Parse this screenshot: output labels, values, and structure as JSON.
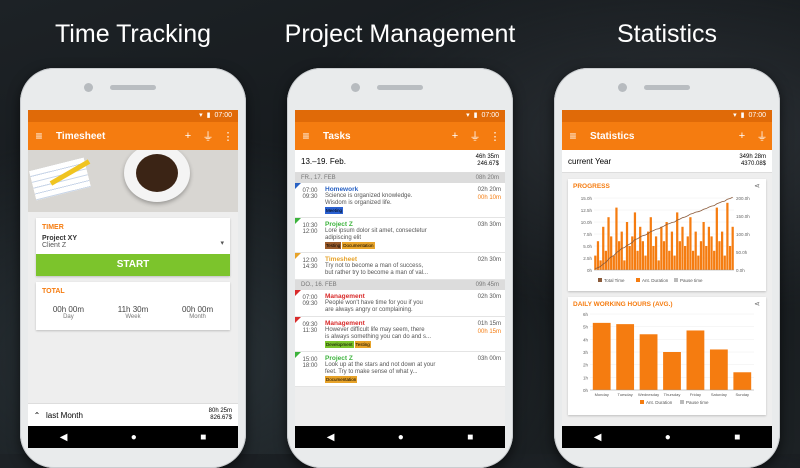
{
  "captions": [
    "Time Tracking",
    "Project Management",
    "Statistics"
  ],
  "status_time": "07:00",
  "nav": {
    "back": "◀",
    "home": "●",
    "recent": "■"
  },
  "timesheet": {
    "title": "Timesheet",
    "timer_label": "TIMER",
    "project": "Project XY",
    "client": "Client Z",
    "start_label": "START",
    "total_label": "TOTAL",
    "totals": [
      {
        "value": "00h 00m",
        "label": "Day"
      },
      {
        "value": "11h 30m",
        "label": "Week"
      },
      {
        "value": "00h 00m",
        "label": "Month"
      }
    ],
    "bottom": {
      "period": "last Month",
      "hours": "80h 25m",
      "amount": "826.67$"
    }
  },
  "tasks": {
    "title": "Tasks",
    "week": {
      "range": "13.–19. Feb.",
      "hours": "46h 35m",
      "amount": "246.67$"
    },
    "days": [
      {
        "label": "FR., 17. FEB",
        "total": "08h 20m",
        "items": [
          {
            "start": "07:00",
            "end": "09:30",
            "title": "Homework",
            "color": "#2962c4",
            "desc": [
              "Science is organized knowledge.",
              "Wisdom is organized life."
            ],
            "dur": "02h 20m",
            "extra": "00h 10m",
            "tags": [
              {
                "text": "Meeting",
                "bg": "#2a60d0"
              }
            ]
          },
          {
            "start": "10:30",
            "end": "12:00",
            "title": "Project Z",
            "color": "#3cb33c",
            "desc": [
              "Lore ipsum dolor sit amet, consectetur",
              "adipiscing elit"
            ],
            "dur": "03h 30m",
            "extra": "",
            "tags": [
              {
                "text": "Testing",
                "bg": "#9a5b2a"
              },
              {
                "text": "Documentation",
                "bg": "#e7a32a"
              }
            ]
          },
          {
            "start": "12:00",
            "end": "14:30",
            "title": "Timesheet",
            "color": "#e7a32a",
            "desc": [
              "Try not to become a man of success,",
              "but rather try to become a man of val..."
            ],
            "dur": "02h 30m",
            "extra": "",
            "tags": []
          }
        ]
      },
      {
        "label": "DO., 16. FEB",
        "total": "09h 45m",
        "items": [
          {
            "start": "07:00",
            "end": "09:30",
            "title": "Management",
            "color": "#d92b2b",
            "desc": [
              "People won't have time for you if you",
              "are always angry or complaining."
            ],
            "dur": "02h 30m",
            "extra": "",
            "tags": []
          },
          {
            "start": "09:30",
            "end": "11:30",
            "title": "Management",
            "color": "#d92b2b",
            "desc": [
              "However difficult life may seem, there",
              "is always something you can do and s..."
            ],
            "dur": "01h 15m",
            "extra": "00h 15m",
            "tags": [
              {
                "text": "Development",
                "bg": "#7cc42c"
              },
              {
                "text": "Testing",
                "bg": "#e7a32a"
              }
            ]
          },
          {
            "start": "15:00",
            "end": "18:00",
            "title": "Project Z",
            "color": "#3cb33c",
            "desc": [
              "Look up at the stars and not down at your",
              "feet. Try to make sense of what y..."
            ],
            "dur": "03h 00m",
            "extra": "",
            "tags": [
              {
                "text": "Documentation",
                "bg": "#e7a32a"
              }
            ]
          }
        ]
      }
    ]
  },
  "statistics": {
    "title": "Statistics",
    "period": "current Year",
    "hours": "349h 28m",
    "amount": "4370.08$",
    "progress_title": "PROGRESS",
    "daily_title": "DAILY WORKING HOURS (AVG.)"
  },
  "chart_data": [
    {
      "type": "bar",
      "title": "PROGRESS",
      "ylabel": "",
      "ylim": [
        0,
        15
      ],
      "y_ticks": [
        "15.0h",
        "12.5h",
        "10.0h",
        "7.5h",
        "5.0h",
        "2.5h",
        "0h"
      ],
      "y2_ticks": [
        "200.0h",
        "150.0h",
        "100.0h",
        "50.0h",
        "0.0h"
      ],
      "legend": [
        "Total Time",
        "Ant. Duration",
        "Pause time"
      ],
      "values": [
        3,
        6,
        2,
        9,
        4,
        11,
        7,
        3,
        13,
        6,
        8,
        2,
        10,
        5,
        7,
        12,
        4,
        9,
        6,
        3,
        8,
        11,
        5,
        7,
        2,
        9,
        6,
        10,
        4,
        8,
        3,
        12,
        6,
        9,
        5,
        7,
        11,
        4,
        8,
        3,
        6,
        10,
        5,
        9,
        7,
        4,
        13,
        6,
        8,
        3,
        14,
        5,
        9
      ],
      "cumulative": [
        5,
        10,
        15,
        25,
        32,
        45,
        55,
        60,
        72,
        80,
        90,
        93,
        102,
        108,
        115,
        127,
        130,
        138,
        143,
        146,
        152,
        160,
        164,
        170,
        172,
        178,
        183,
        190,
        193,
        198,
        200,
        208,
        212,
        218,
        221,
        226,
        233,
        236,
        241,
        243,
        247,
        253,
        256,
        262,
        266,
        268,
        276,
        280,
        285,
        287,
        295,
        298,
        303
      ]
    },
    {
      "type": "bar",
      "title": "DAILY WORKING HOURS (AVG.)",
      "categories": [
        "Monday",
        "Tuesday",
        "Wednesday",
        "Thursday",
        "Friday",
        "Saturday",
        "Sunday"
      ],
      "values": [
        5.3,
        5.2,
        4.4,
        3.0,
        4.7,
        3.2,
        1.4
      ],
      "ylim": [
        0,
        6
      ],
      "y_ticks": [
        "6h",
        "5h",
        "4h",
        "3h",
        "2h",
        "1h",
        "0h"
      ],
      "legend": [
        "Ant. Duration",
        "Pause time"
      ]
    }
  ]
}
